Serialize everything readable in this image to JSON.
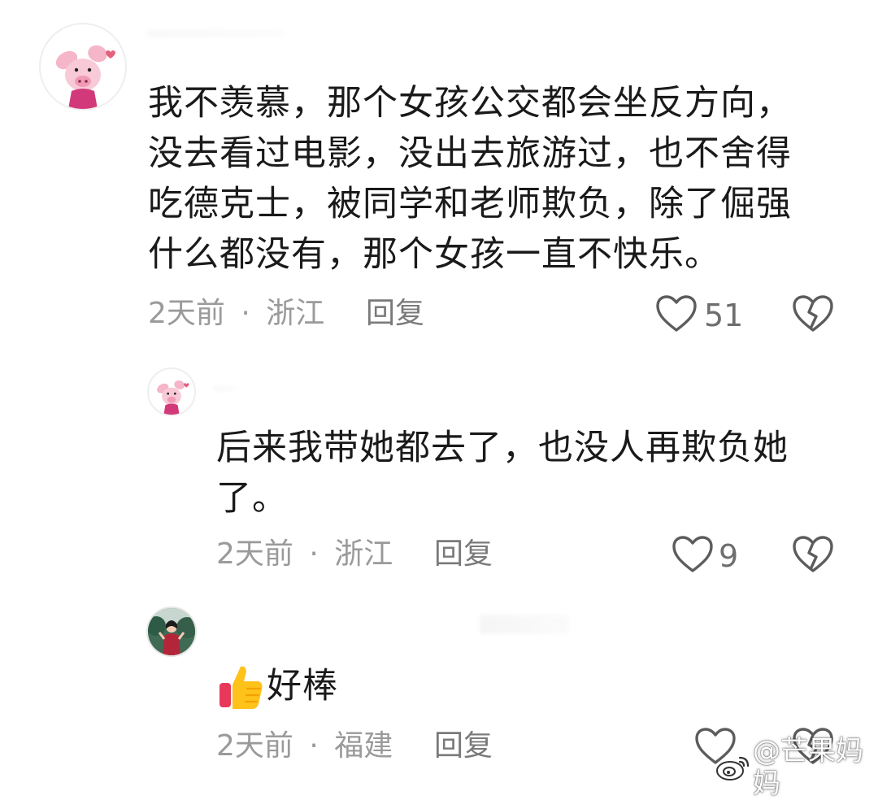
{
  "comments": [
    {
      "text_lines": [
        "我不羡慕，那个女孩公交都会坐反方向，",
        "没去看过电影，没出去旅游过，也不舍得",
        "吃德克士，被同学和老师欺负，除了倔强",
        "什么都没有，那个女孩一直不快乐。"
      ],
      "time": "2天前",
      "separator": "·",
      "location": "浙江",
      "reply_label": "回复",
      "likes": "51",
      "avatar_icon": "piglet-avatar-icon"
    },
    {
      "text_lines": [
        "后来我带她都去了，也没人再欺负她",
        "了。"
      ],
      "time": "2天前",
      "separator": "·",
      "location": "浙江",
      "reply_label": "回复",
      "likes": "9",
      "avatar_icon": "piglet-avatar-icon"
    },
    {
      "emoji_icon": "thumbs-up-icon",
      "text": "好棒",
      "time": "2天前",
      "separator": "·",
      "location": "福建",
      "reply_label": "回复",
      "likes": "",
      "avatar_icon": "photo-avatar-icon"
    }
  ],
  "watermark": {
    "text": "@芒果妈妈",
    "icon": "weibo-icon"
  },
  "colors": {
    "text": "#1a1a1a",
    "meta": "#9a9a9a",
    "piglet_pink": "#f4b6c8",
    "shirt_pink": "#d2397a"
  }
}
